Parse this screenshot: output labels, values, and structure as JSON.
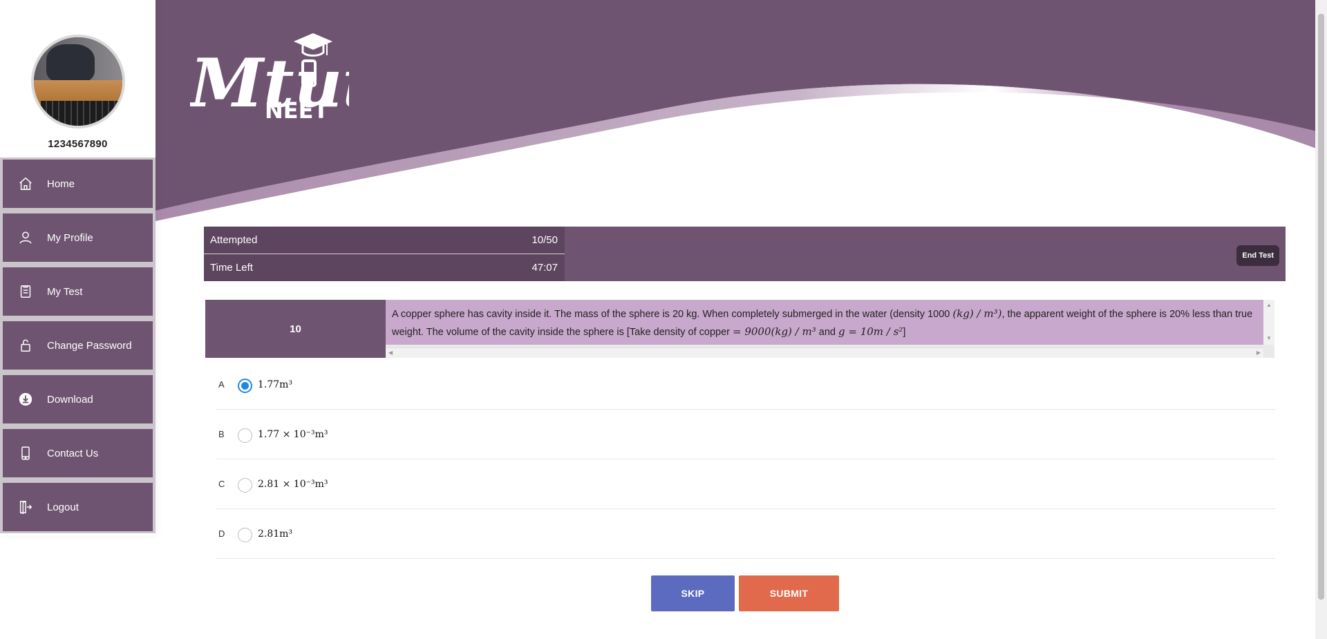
{
  "app": {
    "logo_text": "Mtutor",
    "logo_subtitle": "NEET",
    "colors": {
      "primary": "#6f5471",
      "dark": "#5d455f",
      "question_bg": "#c9a8cd",
      "skip": "#5c6bc0",
      "submit": "#e26a4c",
      "radio_selected": "#1e88e5"
    }
  },
  "sidebar": {
    "username": "1234567890",
    "items": [
      {
        "label": "Home",
        "icon": "home-icon"
      },
      {
        "label": "My Profile",
        "icon": "user-icon"
      },
      {
        "label": "My Test",
        "icon": "test-icon"
      },
      {
        "label": "Change Password",
        "icon": "lock-icon"
      },
      {
        "label": "Download",
        "icon": "download-icon"
      },
      {
        "label": "Contact Us",
        "icon": "phone-icon"
      },
      {
        "label": "Logout",
        "icon": "logout-icon"
      }
    ]
  },
  "status": {
    "attempted_label": "Attempted",
    "attempted_value": "10/50",
    "time_label": "Time Left",
    "time_value": "47:07",
    "end_test_label": "End Test"
  },
  "question": {
    "number": "10",
    "text_part1": "A copper sphere has cavity inside it. The mass of the sphere is 20 kg. When completely submerged in the water (density 1000 ",
    "math1": "(kg) / m³)",
    "text_part2": ", the apparent weight of the sphere is 20% less than true weight. The volume of the cavity inside the sphere is [Take density of copper ",
    "math2": " = 9000(kg) / m³",
    "text_part3": " and ",
    "math3": "g = 10m / s²",
    "text_part4": "]"
  },
  "options": [
    {
      "letter": "A",
      "text": "1.77m³",
      "selected": true
    },
    {
      "letter": "B",
      "text": "1.77 × 10⁻³m³",
      "selected": false
    },
    {
      "letter": "C",
      "text": "2.81 × 10⁻³m³",
      "selected": false
    },
    {
      "letter": "D",
      "text": "2.81m³",
      "selected": false
    }
  ],
  "actions": {
    "skip_label": "SKIP",
    "submit_label": "SUBMIT"
  }
}
